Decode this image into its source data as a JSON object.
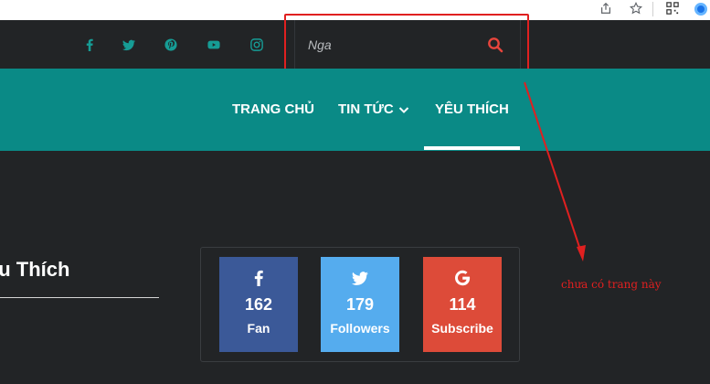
{
  "browser": {
    "icons": [
      "share-icon",
      "star-icon",
      "qr-icon",
      "edge-profile-icon"
    ]
  },
  "social_icons": [
    "facebook-icon",
    "twitter-icon",
    "pinterest-icon",
    "youtube-icon",
    "instagram-icon"
  ],
  "search": {
    "value": "Nga"
  },
  "nav": {
    "items": [
      {
        "label": "TRANG CHỦ"
      },
      {
        "label": "TIN TỨC"
      },
      {
        "label": "YÊU THÍCH"
      }
    ],
    "active": "YÊU THÍCH"
  },
  "widget": {
    "title": "ếu Thích"
  },
  "counters": [
    {
      "network": "facebook",
      "count": "162",
      "label": "Fan",
      "color": "#3b5998"
    },
    {
      "network": "twitter",
      "count": "179",
      "label": "Followers",
      "color": "#55acee"
    },
    {
      "network": "google",
      "count": "114",
      "label": "Subscribe",
      "color": "#dd4b39"
    }
  ],
  "annotation": {
    "text": "chưa có trang này",
    "color": "#e02020"
  },
  "colors": {
    "nav_bg": "#0a8a86",
    "page_bg": "#222426",
    "accent_red": "#e02020"
  }
}
